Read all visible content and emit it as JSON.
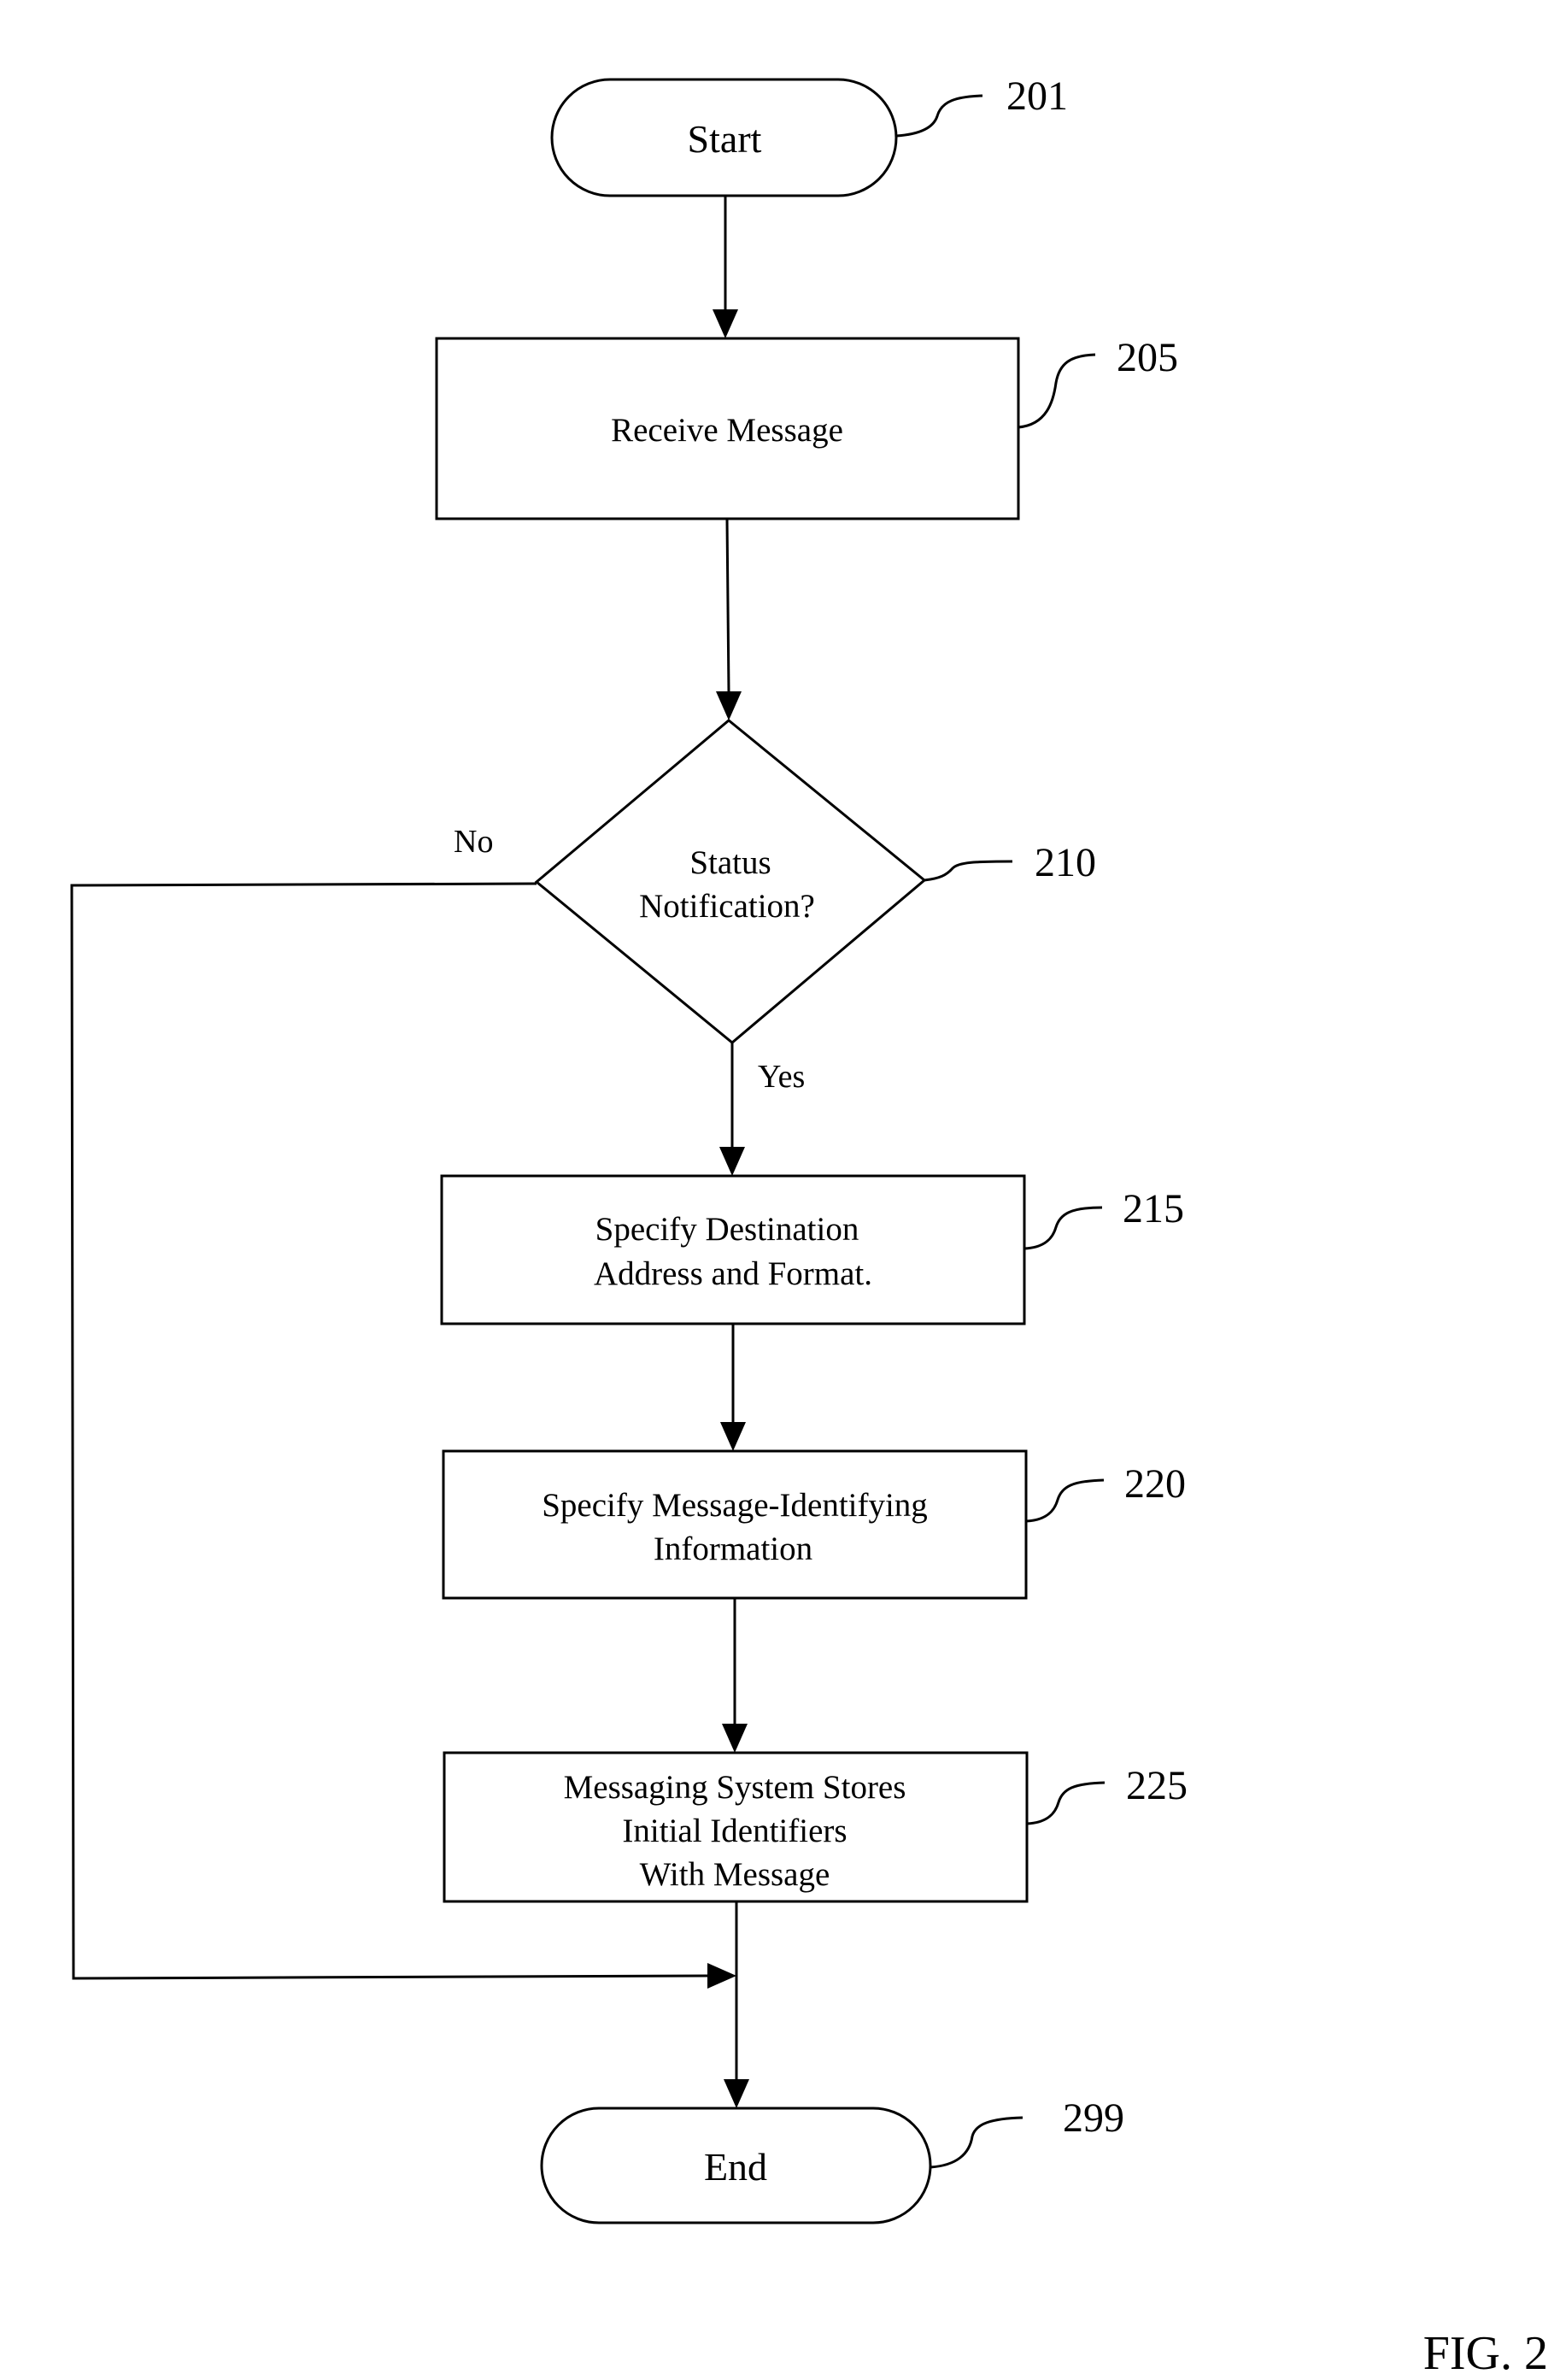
{
  "figure": {
    "label": "FIG. 2",
    "nodes": [
      {
        "id": "201",
        "type": "terminal",
        "lines": [
          "Start"
        ]
      },
      {
        "id": "205",
        "type": "process",
        "lines": [
          "Receive Message"
        ]
      },
      {
        "id": "210",
        "type": "decision",
        "lines": [
          "Status",
          "Notification?"
        ]
      },
      {
        "id": "215",
        "type": "process",
        "lines": [
          "Specify Destination",
          "Address and Format."
        ]
      },
      {
        "id": "220",
        "type": "process",
        "lines": [
          "Specify Message-Identifying",
          "Information"
        ]
      },
      {
        "id": "225",
        "type": "process",
        "lines": [
          "Messaging System Stores",
          "Initial Identifiers",
          "With Message"
        ]
      },
      {
        "id": "299",
        "type": "terminal",
        "lines": [
          "End"
        ]
      }
    ],
    "branches": {
      "no": "No",
      "yes": "Yes"
    },
    "edges": [
      {
        "from": "201",
        "to": "205"
      },
      {
        "from": "205",
        "to": "210"
      },
      {
        "from": "210",
        "to": "215",
        "label": "Yes"
      },
      {
        "from": "210",
        "to": "299",
        "label": "No"
      },
      {
        "from": "215",
        "to": "220"
      },
      {
        "from": "220",
        "to": "225"
      },
      {
        "from": "225",
        "to": "299"
      }
    ]
  }
}
